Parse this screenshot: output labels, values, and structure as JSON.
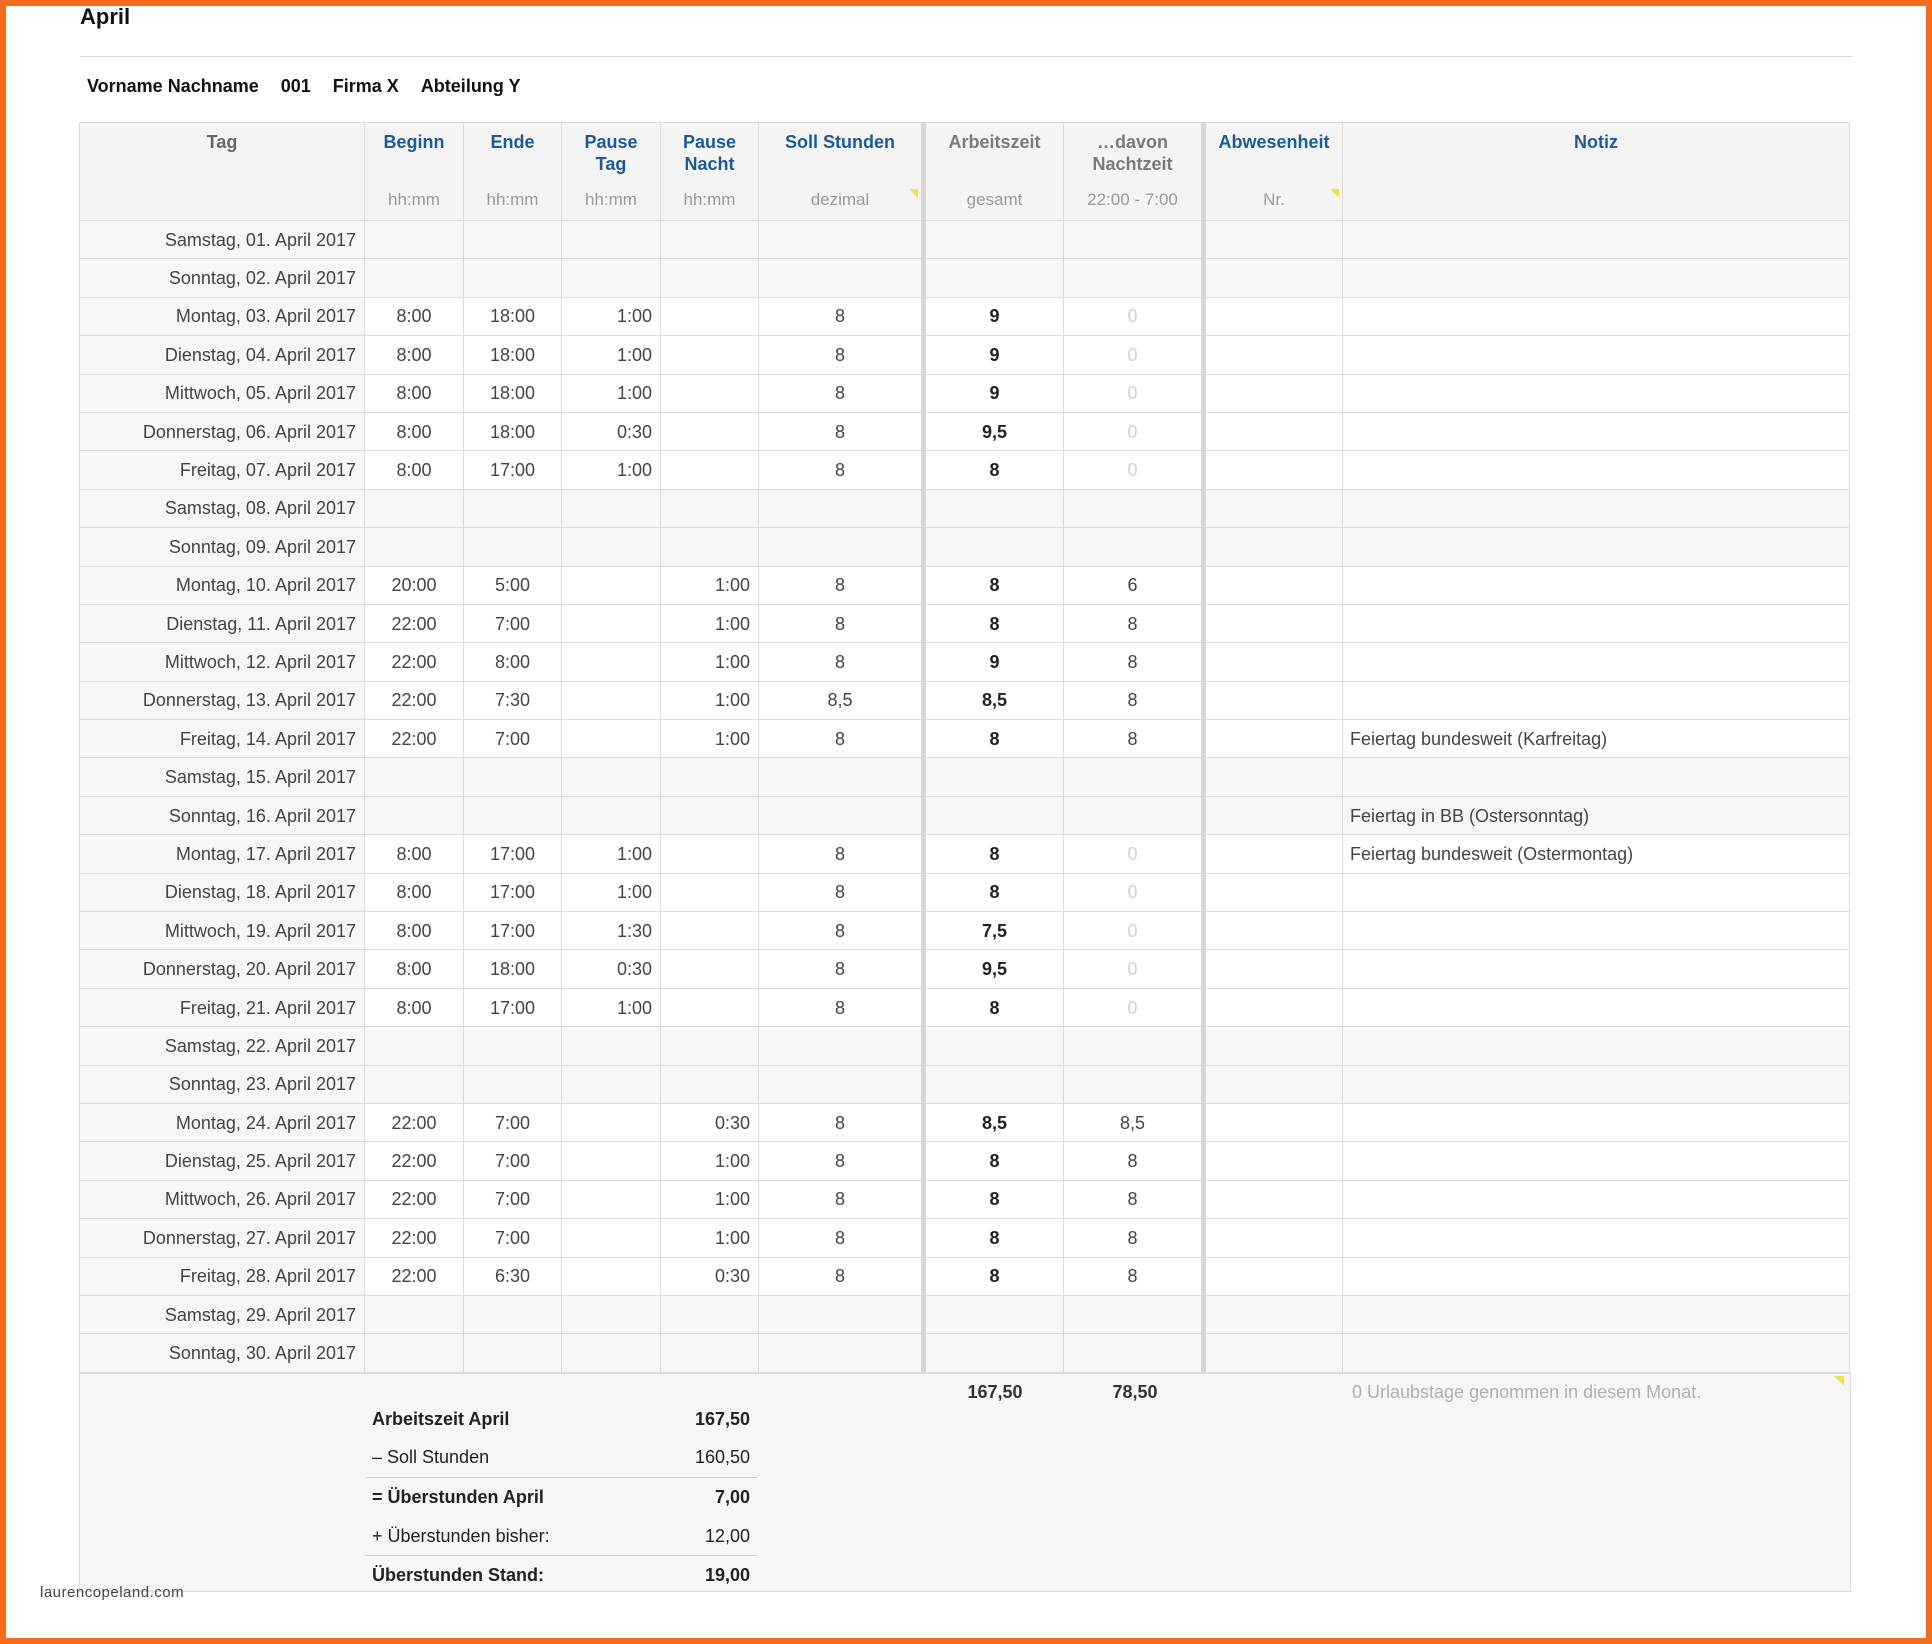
{
  "title": "April",
  "employee": {
    "name": "Vorname Nachname",
    "number": "001",
    "company": "Firma X",
    "department": "Abteilung Y"
  },
  "columns": [
    {
      "label": "Tag",
      "sub": "",
      "color": "gray"
    },
    {
      "label": "Beginn",
      "sub": "hh:mm",
      "color": "blue"
    },
    {
      "label": "Ende",
      "sub": "hh:mm",
      "color": "blue"
    },
    {
      "label": "Pause Tag",
      "sub": "hh:mm",
      "color": "blue"
    },
    {
      "label": "Pause Nacht",
      "sub": "hh:mm",
      "color": "blue"
    },
    {
      "label": "Soll Stunden",
      "sub": "dezimal",
      "color": "blue"
    },
    {
      "label": "Arbeitszeit",
      "sub": "gesamt",
      "color": "gray"
    },
    {
      "label": "…davon Nachtzeit",
      "sub": "22:00 - 7:00",
      "color": "gray"
    },
    {
      "label": "Abwesenheit",
      "sub": "Nr.",
      "color": "blue"
    },
    {
      "label": "Notiz",
      "sub": "",
      "color": "blue"
    }
  ],
  "rows": [
    {
      "day": "Samstag, 01. April 2017",
      "begin": "",
      "end": "",
      "pause_day": "",
      "pause_night": "",
      "target": "",
      "work": "",
      "night": "",
      "absence": "",
      "note": "",
      "weekend": true
    },
    {
      "day": "Sonntag, 02. April 2017",
      "begin": "",
      "end": "",
      "pause_day": "",
      "pause_night": "",
      "target": "",
      "work": "",
      "night": "",
      "absence": "",
      "note": "",
      "weekend": true
    },
    {
      "day": "Montag, 03. April 2017",
      "begin": "8:00",
      "end": "18:00",
      "pause_day": "1:00",
      "pause_night": "",
      "target": "8",
      "work": "9",
      "night": "0",
      "absence": "",
      "note": "",
      "weekend": false
    },
    {
      "day": "Dienstag, 04. April 2017",
      "begin": "8:00",
      "end": "18:00",
      "pause_day": "1:00",
      "pause_night": "",
      "target": "8",
      "work": "9",
      "night": "0",
      "absence": "",
      "note": "",
      "weekend": false
    },
    {
      "day": "Mittwoch, 05. April 2017",
      "begin": "8:00",
      "end": "18:00",
      "pause_day": "1:00",
      "pause_night": "",
      "target": "8",
      "work": "9",
      "night": "0",
      "absence": "",
      "note": "",
      "weekend": false
    },
    {
      "day": "Donnerstag, 06. April 2017",
      "begin": "8:00",
      "end": "18:00",
      "pause_day": "0:30",
      "pause_night": "",
      "target": "8",
      "work": "9,5",
      "night": "0",
      "absence": "",
      "note": "",
      "weekend": false
    },
    {
      "day": "Freitag, 07. April 2017",
      "begin": "8:00",
      "end": "17:00",
      "pause_day": "1:00",
      "pause_night": "",
      "target": "8",
      "work": "8",
      "night": "0",
      "absence": "",
      "note": "",
      "weekend": false
    },
    {
      "day": "Samstag, 08. April 2017",
      "begin": "",
      "end": "",
      "pause_day": "",
      "pause_night": "",
      "target": "",
      "work": "",
      "night": "",
      "absence": "",
      "note": "",
      "weekend": true
    },
    {
      "day": "Sonntag, 09. April 2017",
      "begin": "",
      "end": "",
      "pause_day": "",
      "pause_night": "",
      "target": "",
      "work": "",
      "night": "",
      "absence": "",
      "note": "",
      "weekend": true
    },
    {
      "day": "Montag, 10. April 2017",
      "begin": "20:00",
      "end": "5:00",
      "pause_day": "",
      "pause_night": "1:00",
      "target": "8",
      "work": "8",
      "night": "6",
      "absence": "",
      "note": "",
      "weekend": false
    },
    {
      "day": "Dienstag, 11. April 2017",
      "begin": "22:00",
      "end": "7:00",
      "pause_day": "",
      "pause_night": "1:00",
      "target": "8",
      "work": "8",
      "night": "8",
      "absence": "",
      "note": "",
      "weekend": false
    },
    {
      "day": "Mittwoch, 12. April 2017",
      "begin": "22:00",
      "end": "8:00",
      "pause_day": "",
      "pause_night": "1:00",
      "target": "8",
      "work": "9",
      "night": "8",
      "absence": "",
      "note": "",
      "weekend": false
    },
    {
      "day": "Donnerstag, 13. April 2017",
      "begin": "22:00",
      "end": "7:30",
      "pause_day": "",
      "pause_night": "1:00",
      "target": "8,5",
      "work": "8,5",
      "night": "8",
      "absence": "",
      "note": "",
      "weekend": false
    },
    {
      "day": "Freitag, 14. April 2017",
      "begin": "22:00",
      "end": "7:00",
      "pause_day": "",
      "pause_night": "1:00",
      "target": "8",
      "work": "8",
      "night": "8",
      "absence": "",
      "note": "Feiertag bundesweit (Karfreitag)",
      "weekend": false
    },
    {
      "day": "Samstag, 15. April 2017",
      "begin": "",
      "end": "",
      "pause_day": "",
      "pause_night": "",
      "target": "",
      "work": "",
      "night": "",
      "absence": "",
      "note": "",
      "weekend": true
    },
    {
      "day": "Sonntag, 16. April 2017",
      "begin": "",
      "end": "",
      "pause_day": "",
      "pause_night": "",
      "target": "",
      "work": "",
      "night": "",
      "absence": "",
      "note": "Feiertag in BB (Ostersonntag)",
      "weekend": true
    },
    {
      "day": "Montag, 17. April 2017",
      "begin": "8:00",
      "end": "17:00",
      "pause_day": "1:00",
      "pause_night": "",
      "target": "8",
      "work": "8",
      "night": "0",
      "absence": "",
      "note": "Feiertag bundesweit (Ostermontag)",
      "weekend": false
    },
    {
      "day": "Dienstag, 18. April 2017",
      "begin": "8:00",
      "end": "17:00",
      "pause_day": "1:00",
      "pause_night": "",
      "target": "8",
      "work": "8",
      "night": "0",
      "absence": "",
      "note": "",
      "weekend": false
    },
    {
      "day": "Mittwoch, 19. April 2017",
      "begin": "8:00",
      "end": "17:00",
      "pause_day": "1:30",
      "pause_night": "",
      "target": "8",
      "work": "7,5",
      "night": "0",
      "absence": "",
      "note": "",
      "weekend": false
    },
    {
      "day": "Donnerstag, 20. April 2017",
      "begin": "8:00",
      "end": "18:00",
      "pause_day": "0:30",
      "pause_night": "",
      "target": "8",
      "work": "9,5",
      "night": "0",
      "absence": "",
      "note": "",
      "weekend": false
    },
    {
      "day": "Freitag, 21. April 2017",
      "begin": "8:00",
      "end": "17:00",
      "pause_day": "1:00",
      "pause_night": "",
      "target": "8",
      "work": "8",
      "night": "0",
      "absence": "",
      "note": "",
      "weekend": false
    },
    {
      "day": "Samstag, 22. April 2017",
      "begin": "",
      "end": "",
      "pause_day": "",
      "pause_night": "",
      "target": "",
      "work": "",
      "night": "",
      "absence": "",
      "note": "",
      "weekend": true
    },
    {
      "day": "Sonntag, 23. April 2017",
      "begin": "",
      "end": "",
      "pause_day": "",
      "pause_night": "",
      "target": "",
      "work": "",
      "night": "",
      "absence": "",
      "note": "",
      "weekend": true
    },
    {
      "day": "Montag, 24. April 2017",
      "begin": "22:00",
      "end": "7:00",
      "pause_day": "",
      "pause_night": "0:30",
      "target": "8",
      "work": "8,5",
      "night": "8,5",
      "absence": "",
      "note": "",
      "weekend": false
    },
    {
      "day": "Dienstag, 25. April 2017",
      "begin": "22:00",
      "end": "7:00",
      "pause_day": "",
      "pause_night": "1:00",
      "target": "8",
      "work": "8",
      "night": "8",
      "absence": "",
      "note": "",
      "weekend": false
    },
    {
      "day": "Mittwoch, 26. April 2017",
      "begin": "22:00",
      "end": "7:00",
      "pause_day": "",
      "pause_night": "1:00",
      "target": "8",
      "work": "8",
      "night": "8",
      "absence": "",
      "note": "",
      "weekend": false
    },
    {
      "day": "Donnerstag, 27. April 2017",
      "begin": "22:00",
      "end": "7:00",
      "pause_day": "",
      "pause_night": "1:00",
      "target": "8",
      "work": "8",
      "night": "8",
      "absence": "",
      "note": "",
      "weekend": false
    },
    {
      "day": "Freitag, 28. April 2017",
      "begin": "22:00",
      "end": "6:30",
      "pause_day": "",
      "pause_night": "0:30",
      "target": "8",
      "work": "8",
      "night": "8",
      "absence": "",
      "note": "",
      "weekend": false
    },
    {
      "day": "Samstag, 29. April 2017",
      "begin": "",
      "end": "",
      "pause_day": "",
      "pause_night": "",
      "target": "",
      "work": "",
      "night": "",
      "absence": "",
      "note": "",
      "weekend": true
    },
    {
      "day": "Sonntag, 30. April 2017",
      "begin": "",
      "end": "",
      "pause_day": "",
      "pause_night": "",
      "target": "",
      "work": "",
      "night": "",
      "absence": "",
      "note": "",
      "weekend": true
    }
  ],
  "totals": {
    "work": "167,50",
    "night": "78,50",
    "vacation_note": "0 Urlaubstage genommen in diesem Monat."
  },
  "summary": [
    {
      "label": "Arbeitszeit April",
      "value": "167,50",
      "bold": true,
      "sep": false
    },
    {
      "label": "– Soll Stunden",
      "value": "160,50",
      "bold": false,
      "sep": false
    },
    {
      "label": "= Überstunden April",
      "value": "7,00",
      "bold": true,
      "sep": true
    },
    {
      "label": "+ Überstunden bisher:",
      "value": "12,00",
      "bold": false,
      "sep": false
    },
    {
      "label": "Überstunden Stand:",
      "value": "19,00",
      "bold": true,
      "sep": true
    }
  ],
  "watermark": "laurencopeland.com",
  "colors": {
    "frame": "#f26c1c",
    "header_blue": "#1d5a9a",
    "header_gray": "#7a7a7a",
    "note_flag": "#f5e14a"
  }
}
